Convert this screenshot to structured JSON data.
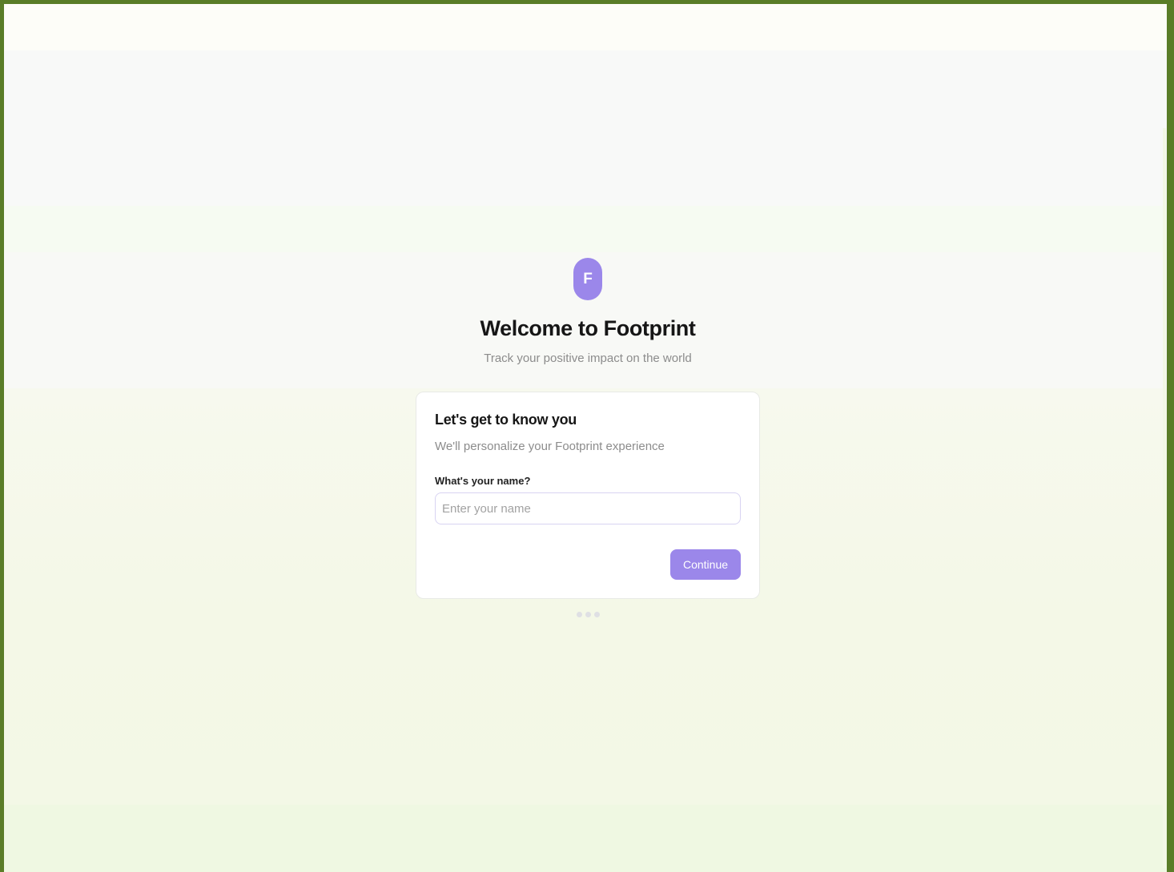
{
  "brand": {
    "logo_letter": "F",
    "accent_color": "#9b87ea"
  },
  "header": {
    "title": "Welcome to Footprint",
    "subtitle": "Track your positive impact on the world"
  },
  "card": {
    "title": "Let's get to know you",
    "description": "We'll personalize your Footprint experience",
    "name_field": {
      "label": "What's your name?",
      "placeholder": "Enter your name",
      "value": ""
    },
    "continue_label": "Continue"
  },
  "progress": {
    "total_steps": 3
  }
}
